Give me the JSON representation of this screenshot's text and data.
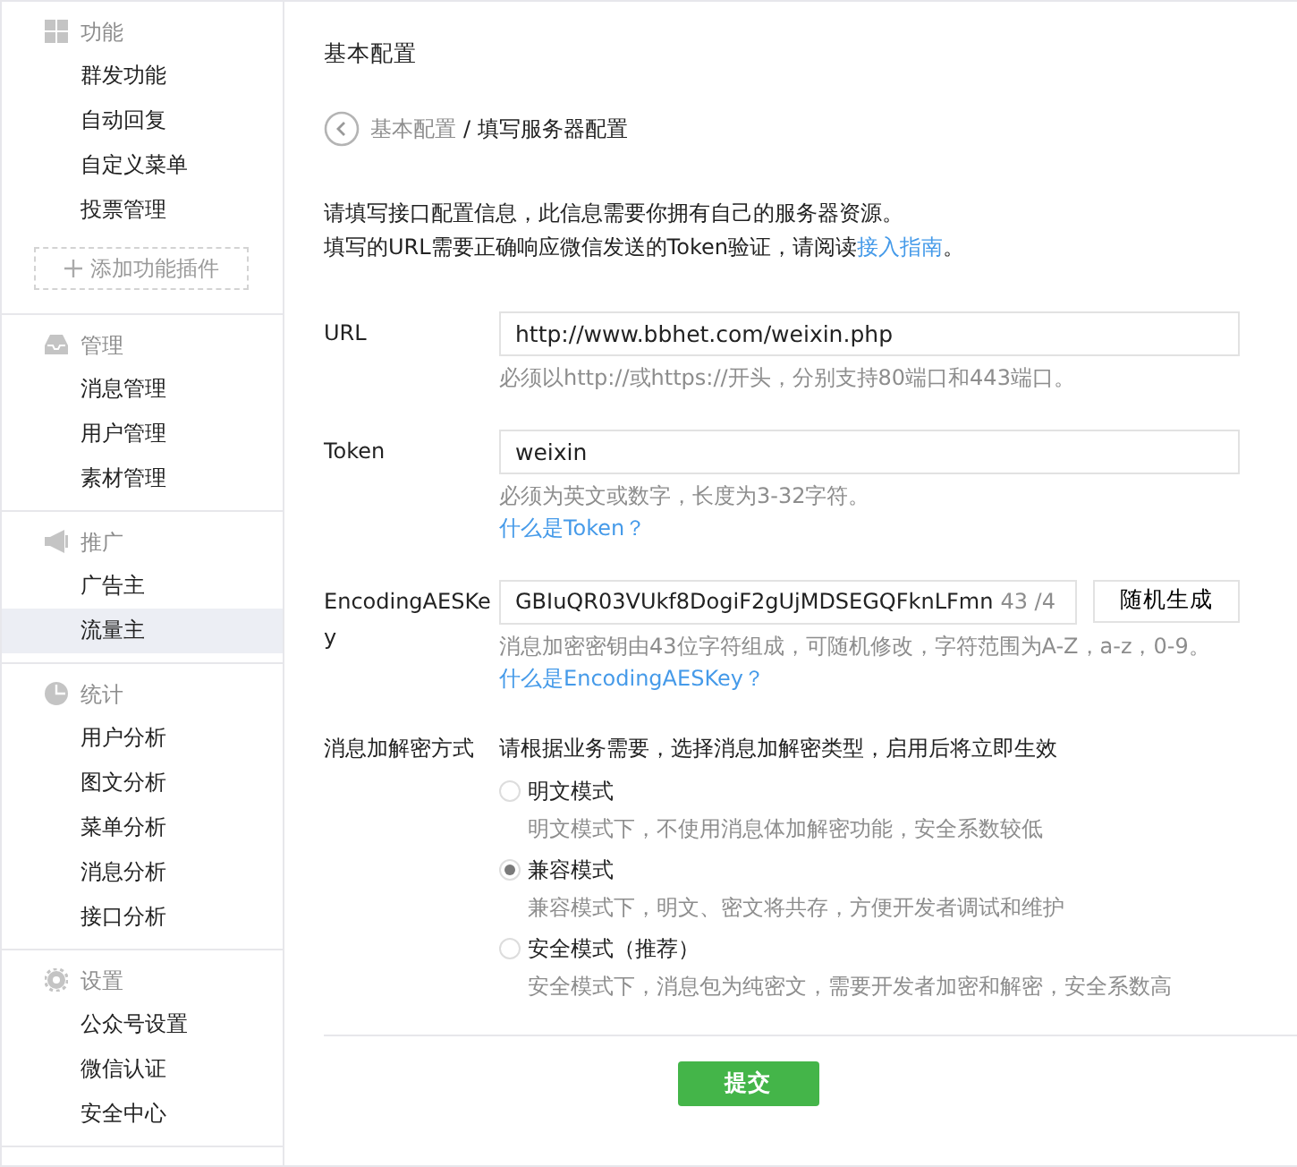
{
  "sidebar": {
    "sections": [
      {
        "title": "功能",
        "items": [
          {
            "label": "群发功能",
            "selected": false
          },
          {
            "label": "自动回复",
            "selected": false
          },
          {
            "label": "自定义菜单",
            "selected": false
          },
          {
            "label": "投票管理",
            "selected": false
          }
        ],
        "add_button": "添加功能插件"
      },
      {
        "title": "管理",
        "items": [
          {
            "label": "消息管理",
            "selected": false
          },
          {
            "label": "用户管理",
            "selected": false
          },
          {
            "label": "素材管理",
            "selected": false
          }
        ]
      },
      {
        "title": "推广",
        "items": [
          {
            "label": "广告主",
            "selected": false
          },
          {
            "label": "流量主",
            "selected": true
          }
        ]
      },
      {
        "title": "统计",
        "items": [
          {
            "label": "用户分析",
            "selected": false
          },
          {
            "label": "图文分析",
            "selected": false
          },
          {
            "label": "菜单分析",
            "selected": false
          },
          {
            "label": "消息分析",
            "selected": false
          },
          {
            "label": "接口分析",
            "selected": false
          }
        ]
      },
      {
        "title": "设置",
        "items": [
          {
            "label": "公众号设置",
            "selected": false
          },
          {
            "label": "微信认证",
            "selected": false
          },
          {
            "label": "安全中心",
            "selected": false
          }
        ]
      }
    ]
  },
  "main": {
    "title": "基本配置",
    "breadcrumb": {
      "parent": "基本配置",
      "separator": "/",
      "current": "填写服务器配置"
    },
    "intro": {
      "line_1": "请填写接口配置信息，此信息需要你拥有自己的服务器资源。",
      "line_2_before": "填写的URL需要正确响应微信发送的Token验证，请阅读",
      "line_2_link": "接入指南",
      "line_2_after": "。"
    },
    "fields": [
      {
        "kind": "text",
        "label": "URL",
        "value": "http://www.bbhet.com/weixin.php",
        "hint": "必须以http://或https://开头，分别支持80端口和443端口。"
      },
      {
        "kind": "text",
        "label": "Token",
        "value": "weixin",
        "hint": "必须为英文或数字，长度为3-32字符。",
        "help_link": "什么是Token？"
      },
      {
        "kind": "key",
        "label": "EncodingAESKey",
        "value": "GBIuQR03VUkf8DogiF2gUjMDSEGQFknLFmn",
        "counter": "43 /4",
        "button": "随机生成",
        "hint": "消息加密密钥由43位字符组成，可随机修改，字符范围为A-Z，a-z，0-9。",
        "help_link": "什么是EncodingAESKey？"
      },
      {
        "kind": "radio",
        "label": "消息加解密方式",
        "prompt": "请根据业务需要，选择消息加解密类型，启用后将立即生效",
        "options": [
          {
            "label": "明文模式",
            "description": "明文模式下，不使用消息体加解密功能，安全系数较低",
            "selected": false
          },
          {
            "label": "兼容模式",
            "description": "兼容模式下，明文、密文将共存，方便开发者调试和维护",
            "selected": true
          },
          {
            "label": "安全模式（推荐）",
            "description": "安全模式下，消息包为纯密文，需要开发者加密和解密，安全系数高",
            "selected": false
          }
        ]
      }
    ],
    "submit": "提交"
  }
}
